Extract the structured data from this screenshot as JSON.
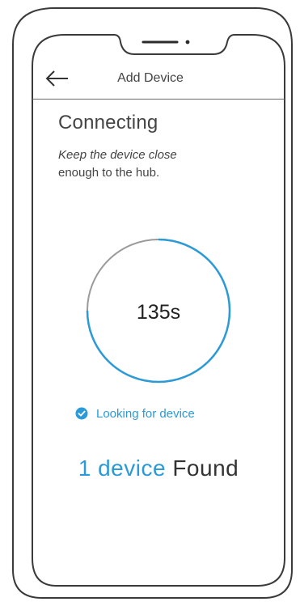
{
  "header": {
    "back_icon": "arrow-left-icon",
    "title": "Add Device"
  },
  "main": {
    "title": "Connecting",
    "subtitle_line1": "Keep the device close",
    "subtitle_line2": "enough to the hub.",
    "countdown": {
      "text": "135s",
      "progress_fraction": 0.25
    },
    "status": {
      "icon": "check-circle-icon",
      "label": "Looking for device"
    },
    "found": {
      "count_text": "1 device",
      "label": "Found"
    }
  },
  "colors": {
    "accent": "#2b9ad6",
    "track": "#9a9a9a",
    "text": "#333333",
    "outline": "#3a3a3a"
  }
}
